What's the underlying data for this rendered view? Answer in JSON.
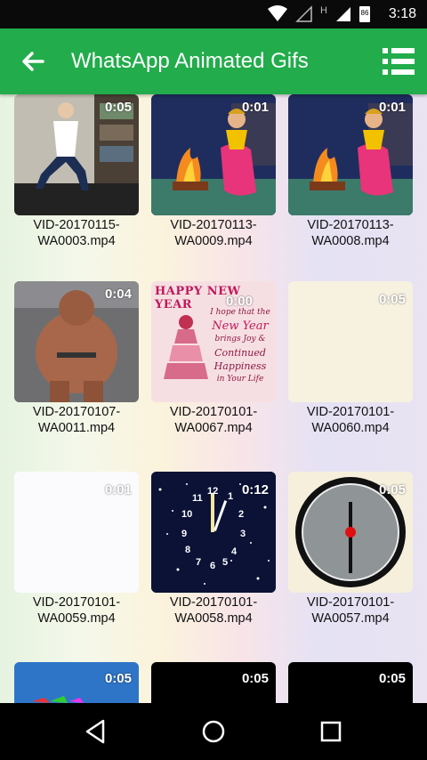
{
  "status_bar": {
    "time": "3:18",
    "battery_level": "86",
    "network_label": "H"
  },
  "app_bar": {
    "title": "WhatsApp Animated Gifs",
    "back_icon": "arrow-left-icon",
    "menu_icon": "list-menu-icon"
  },
  "grid": {
    "items": [
      {
        "name_line1": "VID-20170115-",
        "name_line2": "WA0003.mp4",
        "duration": "0:05"
      },
      {
        "name_line1": "VID-20170113-",
        "name_line2": "WA0009.mp4",
        "duration": "0:01"
      },
      {
        "name_line1": "VID-20170113-",
        "name_line2": "WA0008.mp4",
        "duration": "0:01"
      },
      {
        "name_line1": "VID-20170107-",
        "name_line2": "WA0011.mp4",
        "duration": "0:04"
      },
      {
        "name_line1": "VID-20170101-",
        "name_line2": "WA0067.mp4",
        "duration": "0:00"
      },
      {
        "name_line1": "VID-20170101-",
        "name_line2": "WA0060.mp4",
        "duration": "0:05"
      },
      {
        "name_line1": "VID-20170101-",
        "name_line2": "WA0059.mp4",
        "duration": "0:01"
      },
      {
        "name_line1": "VID-20170101-",
        "name_line2": "WA0058.mp4",
        "duration": "0:12"
      },
      {
        "name_line1": "VID-20170101-",
        "name_line2": "WA0057.mp4",
        "duration": "0:05"
      },
      {
        "duration": "0:05"
      },
      {
        "duration": "0:05"
      },
      {
        "duration": "0:05"
      }
    ],
    "card_texts": {
      "happy_new_year": "HAPPY NEW YEAR",
      "line1": "I hope that the",
      "line2": "New Year",
      "line3": "brings Joy &",
      "line4": "Continued",
      "line5": "Happiness",
      "line6": "in Your Life"
    },
    "clock_numbers": [
      "12",
      "1",
      "2",
      "3",
      "4",
      "5",
      "6",
      "7",
      "8",
      "9",
      "10",
      "11"
    ]
  },
  "nav_bar": {
    "back_icon": "triangle-back-icon",
    "home_icon": "circle-home-icon",
    "recents_icon": "square-recents-icon"
  }
}
